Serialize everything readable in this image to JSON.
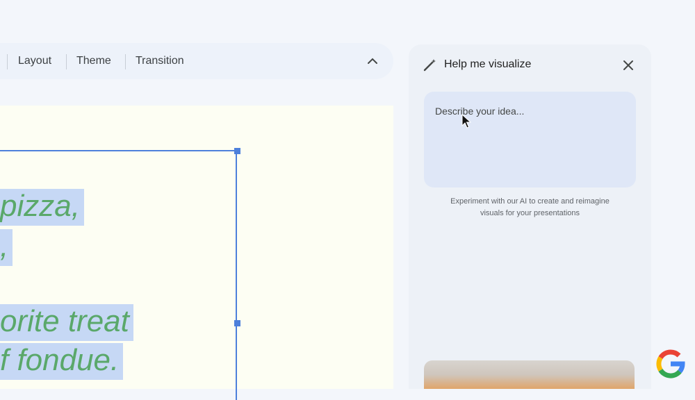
{
  "toolbar": {
    "items": [
      "Layout",
      "Theme",
      "Transition"
    ]
  },
  "slide": {
    "lines": [
      "pizza,",
      ",",
      "orite treat",
      "f fondue."
    ]
  },
  "panel": {
    "title": "Help me visualize",
    "input_placeholder": "Describe your idea...",
    "caption_line1": "Experiment with our AI to create and reimagine",
    "caption_line2": "visuals for your presentations"
  },
  "colors": {
    "accent": "#4d80db",
    "slide_text": "#5aa86a",
    "highlight": "#c6d8f5"
  },
  "icons": {
    "wand": "magic-wand-icon",
    "close": "close-icon",
    "caret": "chevron-up-icon",
    "logo": "google-logo-icon"
  }
}
